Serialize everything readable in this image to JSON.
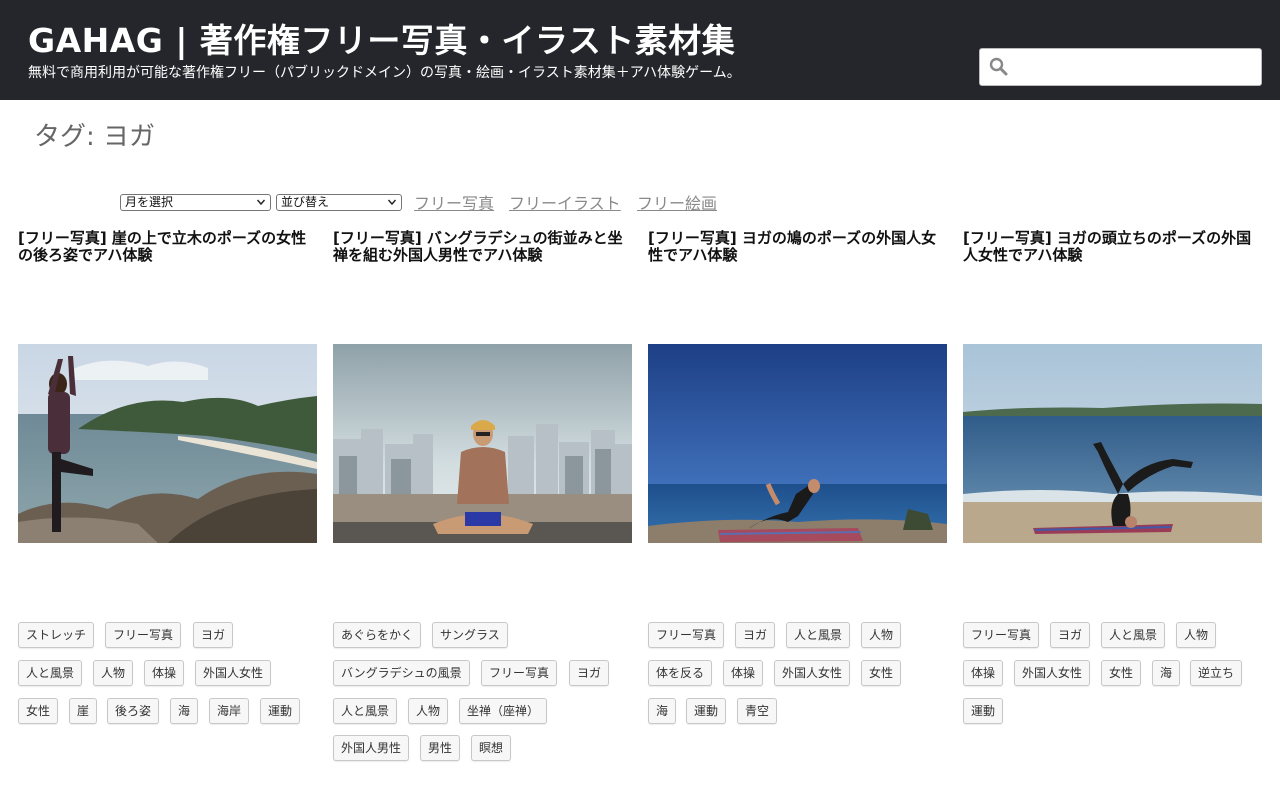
{
  "header": {
    "site_title": "GAHAG | 著作権フリー写真・イラスト素材集",
    "site_description": "無料で商用利用が可能な著作権フリー（パブリックドメイン）の写真・絵画・イラスト素材集＋アハ体験ゲーム。",
    "search": {
      "placeholder": "",
      "value": "",
      "icon": "search-icon"
    },
    "colors": {
      "background": "#24262b",
      "text": "#ffffff"
    }
  },
  "archive": {
    "title": "タグ: ヨガ"
  },
  "filters": {
    "month_select": "月を選択",
    "sort_select": "並び替え",
    "links": [
      "フリー写真",
      "フリーイラスト",
      "フリー絵画"
    ]
  },
  "posts": [
    {
      "title": "[フリー写真] 崖の上で立木のポーズの女性の後ろ姿でアハ体験",
      "image": "woman-tree-pose-on-cliff-photo",
      "tags": [
        "ストレッチ",
        "フリー写真",
        "ヨガ",
        "人と風景",
        "人物",
        "体操",
        "外国人女性",
        "女性",
        "崖",
        "後ろ姿",
        "海",
        "海岸",
        "運動"
      ]
    },
    {
      "title": "[フリー写真] バングラデシュの街並みと坐禅を組む外国人男性でアハ体験",
      "image": "man-meditating-city-rooftop-photo",
      "tags": [
        "あぐらをかく",
        "サングラス",
        "バングラデシュの風景",
        "フリー写真",
        "ヨガ",
        "人と風景",
        "人物",
        "坐禅（座禅）",
        "外国人男性",
        "男性",
        "瞑想"
      ]
    },
    {
      "title": "[フリー写真] ヨガの鳩のポーズの外国人女性でアハ体験",
      "image": "woman-pigeon-pose-seaside-photo",
      "tags": [
        "フリー写真",
        "ヨガ",
        "人と風景",
        "人物",
        "体を反る",
        "体操",
        "外国人女性",
        "女性",
        "海",
        "運動",
        "青空"
      ]
    },
    {
      "title": "[フリー写真] ヨガの頭立ちのポーズの外国人女性でアハ体験",
      "image": "woman-headstand-beach-photo",
      "tags": [
        "フリー写真",
        "ヨガ",
        "人と風景",
        "人物",
        "体操",
        "外国人女性",
        "女性",
        "海",
        "逆立ち",
        "運動"
      ]
    }
  ]
}
